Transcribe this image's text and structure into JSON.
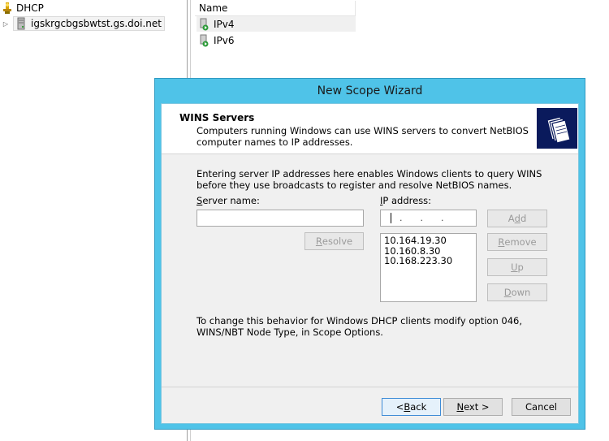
{
  "tree": {
    "root_label": "DHCP",
    "server_label": "igskrgcbgsbwtst.gs.doi.net"
  },
  "list": {
    "header": "Name",
    "rows": [
      "IPv4",
      "IPv6"
    ]
  },
  "dialog": {
    "title": "New Scope Wizard",
    "banner_title": "WINS Servers",
    "banner_desc": "Computers running Windows can use WINS servers to convert NetBIOS computer names to IP addresses.",
    "body_text": "Entering server IP addresses here enables Windows clients to query WINS before they use broadcasts to register and resolve NetBIOS names.",
    "server_name_label_accel": "S",
    "server_name_label_rest": "erver name:",
    "ip_label_accel": "I",
    "ip_label_rest": "P address:",
    "server_name_value": "",
    "ip_value": ". . .",
    "buttons": {
      "resolve_accel": "R",
      "resolve_rest": "esolve",
      "add_accel": "d",
      "add_pre": "A",
      "add_rest": "d",
      "remove_accel": "R",
      "remove_rest": "emove",
      "up_accel": "U",
      "up_rest": "p",
      "down_accel": "D",
      "down_rest": "own",
      "back_pre": "< ",
      "back_accel": "B",
      "back_rest": "ack",
      "next_accel": "N",
      "next_rest": "ext >",
      "cancel": "Cancel"
    },
    "wins_servers": [
      "10.164.19.30",
      "10.160.8.30",
      "10.168.223.30"
    ],
    "footer_text": "To change this behavior for Windows DHCP clients modify option 046, WINS/NBT Node Type, in Scope Options."
  }
}
